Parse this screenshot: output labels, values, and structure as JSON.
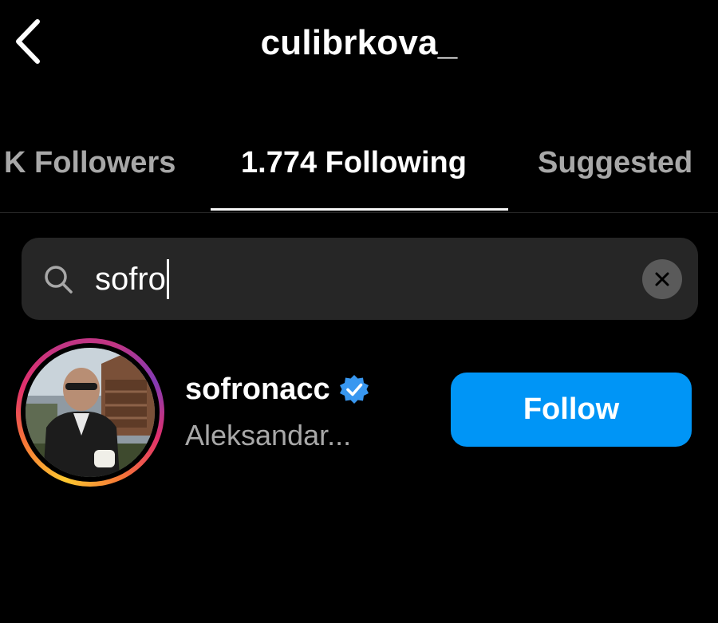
{
  "header": {
    "title": "culibrkova_",
    "back_icon": "chevron-left-icon"
  },
  "tabs": [
    {
      "label": "K Followers",
      "active": false
    },
    {
      "label": "1.774 Following",
      "active": true
    },
    {
      "label": "Suggested",
      "active": false
    }
  ],
  "search": {
    "value": "sofro",
    "icon": "search-icon",
    "clear_icon": "close-icon"
  },
  "results": [
    {
      "username": "sofronacc",
      "verified": true,
      "full_name": "Aleksandar...",
      "action_label": "Follow"
    }
  ],
  "colors": {
    "background": "#000000",
    "search_bg": "#262626",
    "accent": "#0095f6",
    "muted_text": "#a8a8a8",
    "verified": "#3897f0"
  }
}
